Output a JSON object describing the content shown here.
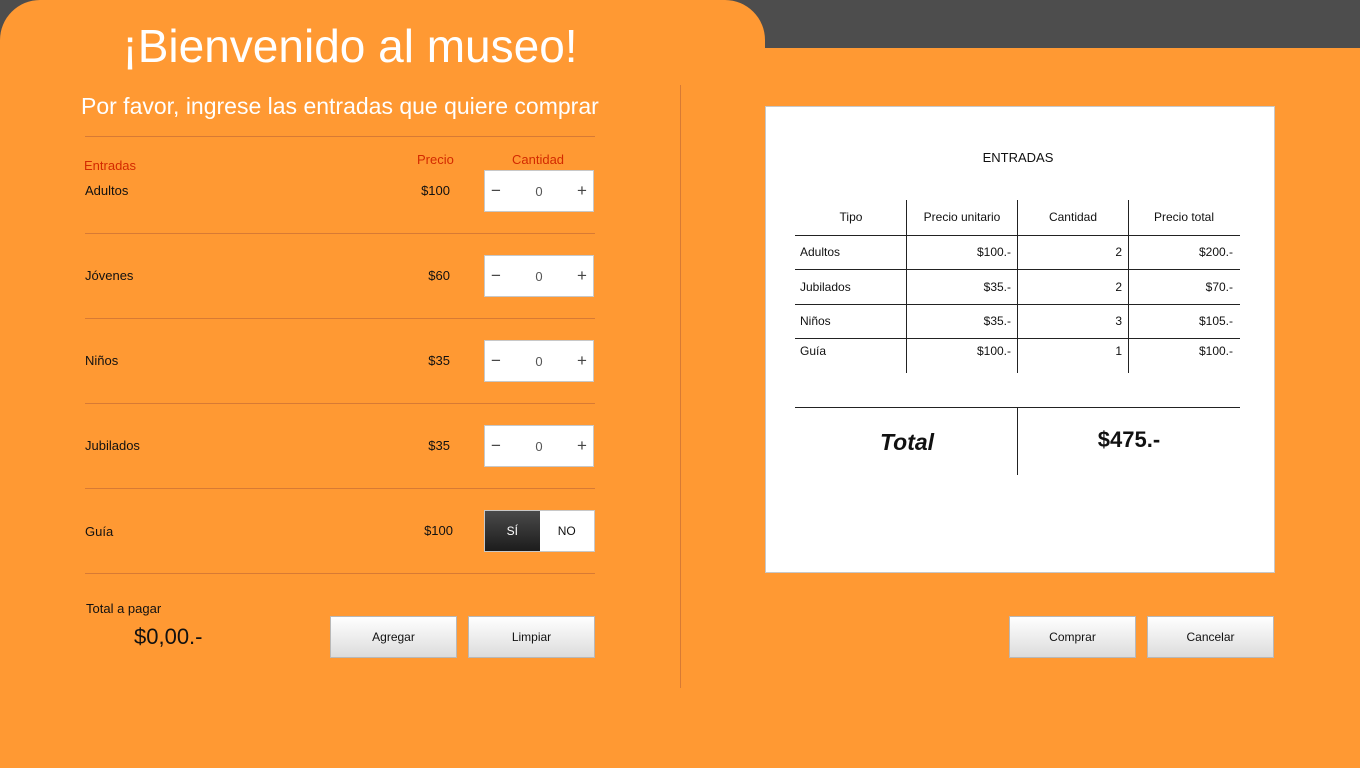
{
  "header": {
    "title": "¡Bienvenido al museo!",
    "subtitle": "Por favor, ingrese las entradas que quiere comprar"
  },
  "form": {
    "col_entradas": "Entradas",
    "col_precio": "Precio",
    "col_cantidad": "Cantidad",
    "rows": [
      {
        "label": "Adultos",
        "price": "$100",
        "qty": "0"
      },
      {
        "label": "Jóvenes",
        "price": "$60",
        "qty": "0"
      },
      {
        "label": "Niños",
        "price": "$35",
        "qty": "0"
      },
      {
        "label": "Jubilados",
        "price": "$35",
        "qty": "0"
      }
    ],
    "guide": {
      "label": "Guía",
      "price": "$100",
      "yes": "SÍ",
      "no": "NO",
      "selected": "SÍ"
    },
    "minus_symbol": "−",
    "plus_symbol": "+",
    "total_label": "Total a pagar",
    "total_value": "$0,00.-",
    "add_button": "Agregar",
    "clear_button": "Limpiar"
  },
  "receipt": {
    "title": "ENTRADAS",
    "headers": [
      "Tipo",
      "Precio unitario",
      "Cantidad",
      "Precio total"
    ],
    "rows": [
      {
        "tipo": "Adultos",
        "unit": "$100.-",
        "qty": "2",
        "total": "$200.-"
      },
      {
        "tipo": "Jubilados",
        "unit": "$35.-",
        "qty": "2",
        "total": "$70.-"
      },
      {
        "tipo": "Niños",
        "unit": "$35.-",
        "qty": "3",
        "total": "$105.-"
      },
      {
        "tipo": "Guía",
        "unit": "$100.-",
        "qty": "1",
        "total": "$100.-"
      }
    ],
    "total_label": "Total",
    "total_value": "$475.-"
  },
  "actions": {
    "buy_button": "Comprar",
    "cancel_button": "Cancelar"
  },
  "colors": {
    "background": "#ff9933",
    "topbar": "#4d4d4d",
    "header_text": "#d32a00"
  }
}
